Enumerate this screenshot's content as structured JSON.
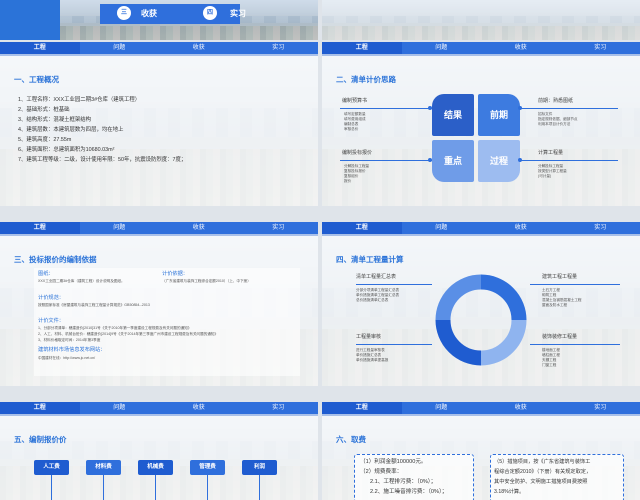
{
  "nav_tabs": [
    "工程",
    "问题",
    "收获",
    "实习"
  ],
  "slide1": {
    "items": [
      {
        "num": "三",
        "label": "收获"
      },
      {
        "num": "四",
        "label": "实习"
      }
    ]
  },
  "slide2": {
    "title": "一、工程概况",
    "items": [
      "1、工程名称：XXX工业园二期3#仓库（建筑工程）",
      "2、基础形式：桩基础",
      "3、结构形式：混凝土框架结构",
      "4、建筑层数：本建筑层数为四层，均在地上",
      "5、建筑高度：27.55m",
      "6、建筑面积：总建筑面积为10680.03m²",
      "7、建筑工程等级：二级，设计使用年限：50年，抗震设防烈度：7度；"
    ]
  },
  "slide3": {
    "title": "二、清单计价思路",
    "quadrants": [
      "结果",
      "前期",
      "重点",
      "过程"
    ],
    "left_top": {
      "head": "编制预算书",
      "lines": [
        "填写定额数量",
        "填写费用组成",
        "编制总表",
        "审核总价"
      ]
    },
    "left_bottom": {
      "head": "编制投标报价",
      "lines": [
        "分解投标工程量",
        "复核投标报价",
        "复核组价",
        "报价"
      ]
    },
    "right_top": {
      "head": "前期：熟悉图纸",
      "lines": [
        "招标文件",
        "指定规则依据、细部节点",
        "利用本项目计价方法"
      ]
    },
    "right_bottom": {
      "head": "计算工程量",
      "lines": [
        "分解投标工程量",
        "按类型计算工程量",
        "(可计量)"
      ]
    }
  },
  "slide4": {
    "title": "三、投标报价的编制依据",
    "blocks": [
      {
        "head": "图纸：",
        "lines": [
          "XXX工业园二期3#仓库（建筑工程）设计说明及图纸。"
        ]
      },
      {
        "head": "计价依据：",
        "lines": [
          "（广东省建筑与装饰工程综合定额2010）（上、中下册）"
        ]
      },
      {
        "head": "计价规范：",
        "lines": [
          "按照国家标准《房屋建筑与装饰工程工程量计算规范》GB50854--2013"
        ]
      },
      {
        "head": "计价文件：",
        "lines": [
          "1、分部分项清单：穗建造价[2010]31号《关于2010年第一季度建设工程规费及有关问题的通知》",
          "2、人工、材料、机械台班价：穗建造价[2014]9号《关于2014年第三季度广州市建设工程规费及有关问题的通知》",
          "3、材料价格取定时间：2014年第3季度"
        ]
      },
      {
        "head": "建筑材料市场信息发布网站：",
        "lines": [
          "中国建材在线：http://www.jc.net.cn/"
        ]
      }
    ]
  },
  "slide5": {
    "title": "四、清单工程量计算",
    "left_top": {
      "head": "清单工程量汇总表",
      "lines": [
        "分部分项清单工程量汇总表",
        "单价措施清单工程量汇总表",
        "总价措施清单汇总表"
      ]
    },
    "left_bottom": {
      "head": "工程量审核",
      "lines": [
        "进行工程量审核表",
        "单价措施汇总表",
        "单价措施清单提高报"
      ]
    },
    "right_top": {
      "head": "建筑工程工程量",
      "lines": [
        "土石方工程",
        "砌筑工程",
        "混凝土及钢筋混凝土工程",
        "屋面及防水工程"
      ]
    },
    "right_bottom": {
      "head": "装饰装修工程量",
      "lines": [
        "楼地面工程",
        "墙柱面工程",
        "天棚工程",
        "门窗工程"
      ]
    }
  },
  "slide6": {
    "title": "五、编制报价价",
    "chips": [
      "人工费",
      "材料费",
      "机械费",
      "管理费",
      "利润"
    ]
  },
  "slide7": {
    "title": "六、取费",
    "left_lines": [
      "（1）利润金额100000元。",
      "（2）规费费率：",
      "2.1、工程排污费：（0%）；",
      "2.2、施工噪音排污费：（0%）；"
    ],
    "right_lines": [
      "（5）措施项目，按《广东省建筑与装饰工",
      "程综合定额2010》（下册）有关规定取定，",
      "其中安全防护、文明施工措施项目费按照",
      "3.18%计算。"
    ]
  },
  "colors": {
    "primary": "#2f6fdc",
    "dark": "#1f5cd0",
    "light": "#8fb4ef"
  }
}
